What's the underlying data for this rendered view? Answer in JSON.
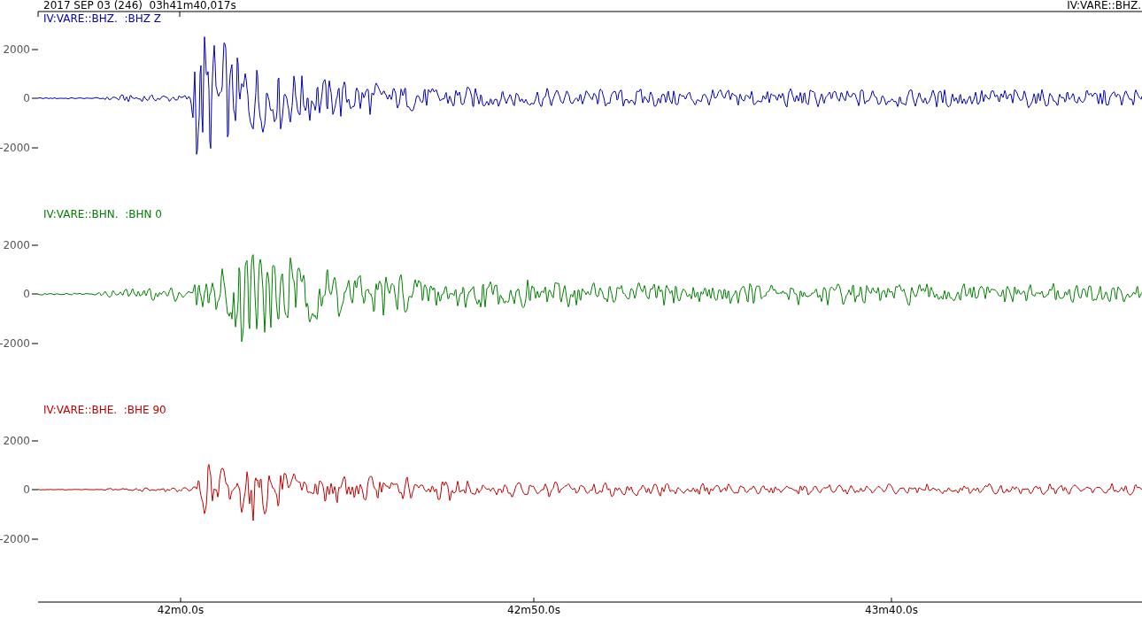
{
  "header": {
    "date_time": "2017 SEP 03 (246)  03h41m40,017s",
    "station": "IV:VARE::BHZ."
  },
  "traces": [
    {
      "label": "IV:VARE::BHZ.  :BHZ Z",
      "color": "#0000b4",
      "y_ticks": [
        "2000",
        "0",
        "-2000"
      ]
    },
    {
      "label": "IV:VARE::BHN.  :BHN 0",
      "color": "#008000",
      "y_ticks": [
        "2000",
        "0",
        "-2000"
      ]
    },
    {
      "label": "IV:VARE::BHE.  :BHE 90",
      "color": "#c00000",
      "y_ticks": [
        "2000",
        "0",
        "-2000"
      ]
    }
  ],
  "x_axis": {
    "ticks": [
      "42m0.0s",
      "42m50.0s",
      "43m40.0s"
    ]
  }
}
